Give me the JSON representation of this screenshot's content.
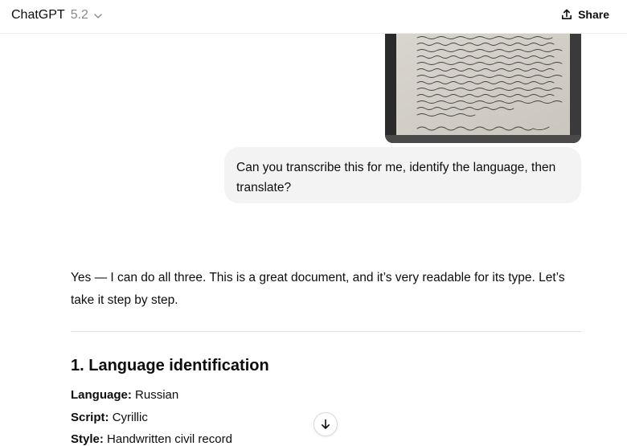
{
  "header": {
    "model_name": "ChatGPT",
    "model_version": "5.2",
    "share_label": "Share"
  },
  "conversation": {
    "user_message": "Can you transcribe this for me, identify the language, then translate?",
    "assistant": {
      "intro": "Yes — I can do all three. This is a great document, and it’s very readable for its type. Let’s take it step by step.",
      "section_title": "1. Language identification",
      "facts": [
        {
          "label": "Language:",
          "value": "Russian"
        },
        {
          "label": "Script:",
          "value": "Cyrillic"
        },
        {
          "label": "Style:",
          "value": "Handwritten civil record"
        }
      ]
    }
  },
  "icons": {
    "model_chevron": "chevron-down-icon",
    "share": "share-upload-icon",
    "scroll": "arrow-down-icon"
  },
  "colors": {
    "bubble_bg": "#f3f3f3",
    "text": "#0d0d0d",
    "muted": "#8a8a8a"
  }
}
